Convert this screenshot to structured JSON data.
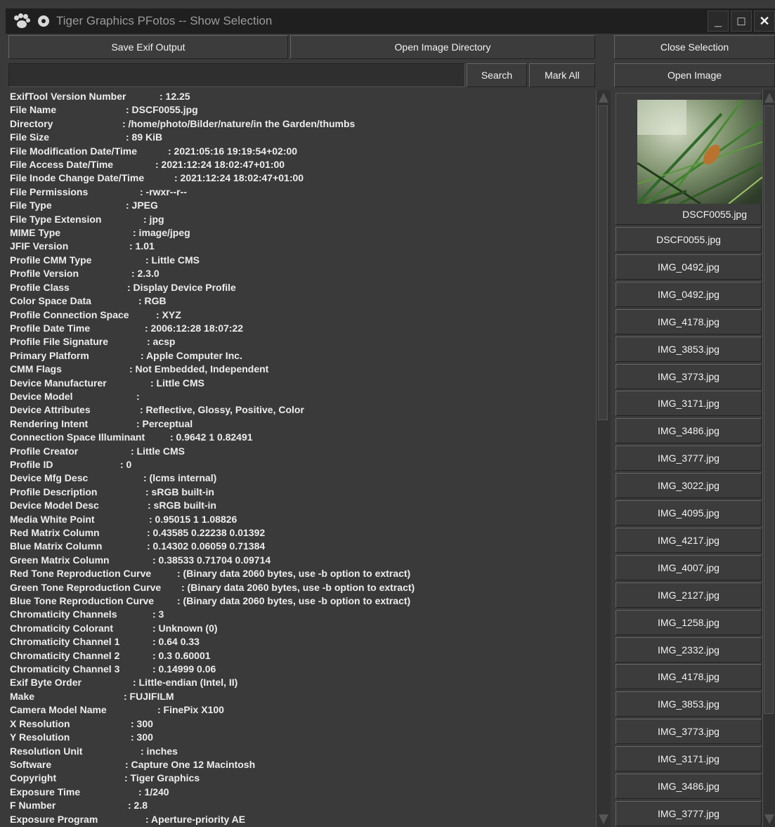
{
  "window": {
    "title": "Tiger Graphics PFotos -- Show Selection",
    "minimize": "_",
    "maximize": "□",
    "close": "✕"
  },
  "toolbar": {
    "save_exif": "Save Exif Output",
    "open_dir": "Open Image Directory",
    "close_selection": "Close Selection",
    "search": "Search",
    "mark_all": "Mark All",
    "open_image": "Open Image",
    "search_value": ""
  },
  "exif": [
    [
      "ExifTool Version Number",
      ": 12.25",
      213
    ],
    [
      "File Name",
      ": DSCF0055.jpg",
      165
    ],
    [
      "Directory",
      ": /home/photo/Bilder/nature/in the Garden/thumbs",
      160
    ],
    [
      "File Size",
      ": 89 KiB",
      165
    ],
    [
      "File Modification Date/Time",
      ": 2021:05:16 19:19:54+02:00",
      225
    ],
    [
      "File Access Date/Time",
      ": 2021:12:24 18:02:47+01:00",
      207
    ],
    [
      "File Inode Change Date/Time",
      ": 2021:12:24 18:02:47+01:00",
      234
    ],
    [
      "File Permissions",
      ": -rwxr--r--",
      185
    ],
    [
      "File Type",
      ": JPEG",
      165
    ],
    [
      "File Type Extension",
      ": jpg",
      190
    ],
    [
      "MIME Type",
      ": image/jpeg",
      175
    ],
    [
      "JFIF Version",
      ": 1.01",
      170
    ],
    [
      "Profile CMM Type",
      ": Little CMS",
      193
    ],
    [
      "Profile Version",
      ": 2.3.0",
      173
    ],
    [
      "Profile Class",
      ": Display Device Profile",
      167
    ],
    [
      "Color Space Data",
      ": RGB",
      183
    ],
    [
      "Profile Connection Space",
      ": XYZ",
      208
    ],
    [
      "Profile Date Time",
      ": 2006:12:28 18:07:22",
      192
    ],
    [
      "Profile File Signature",
      ": acsp",
      195
    ],
    [
      "Primary Platform",
      ": Apple Computer Inc.",
      186
    ],
    [
      "CMM Flags",
      ": Not Embedded, Independent",
      170
    ],
    [
      "Device Manufacturer",
      ": Little CMS",
      200
    ],
    [
      "Device Model",
      ":",
      180
    ],
    [
      "Device Attributes",
      ": Reflective, Glossy, Positive, Color",
      185
    ],
    [
      "Rendering Intent",
      ": Perceptual",
      180
    ],
    [
      "Connection Space Illuminant",
      ": 0.9642 1 0.82491",
      228
    ],
    [
      "Profile Creator",
      ": Little CMS",
      172
    ],
    [
      "Profile ID",
      ": 0",
      157
    ],
    [
      "Device Mfg Desc",
      ": (lcms internal)",
      190
    ],
    [
      "Profile Description",
      ": sRGB built-in",
      193
    ],
    [
      "Device Model Desc",
      ": sRGB built-in",
      196
    ],
    [
      "Media White Point",
      ": 0.95015 1 1.08826",
      198
    ],
    [
      "Red Matrix Column",
      ": 0.43585 0.22238 0.01392",
      195
    ],
    [
      "Blue Matrix Column",
      ": 0.14302 0.06059 0.71384",
      195
    ],
    [
      "Green Matrix Column",
      ": 0.38533 0.71704 0.09714",
      203
    ],
    [
      "Red Tone Reproduction Curve",
      ": (Binary data 2060 bytes, use -b option to extract)",
      238
    ],
    [
      "Green Tone Reproduction Curve",
      ": (Binary data 2060 bytes, use -b option to extract)",
      244
    ],
    [
      "Blue Tone Reproduction Curve",
      ": (Binary data 2060 bytes, use -b option to extract)",
      238
    ],
    [
      "Chromaticity Channels",
      ": 3",
      203
    ],
    [
      "Chromaticity Colorant",
      ": Unknown (0)",
      203
    ],
    [
      "Chromaticity Channel 1",
      ": 0.64 0.33",
      203
    ],
    [
      "Chromaticity Channel 2",
      ": 0.3 0.60001",
      203
    ],
    [
      "Chromaticity Channel 3",
      ": 0.14999 0.06",
      203
    ],
    [
      "Exif Byte Order",
      ": Little-endian (Intel, II)",
      175
    ],
    [
      "Make",
      ": FUJIFILM",
      162
    ],
    [
      "Camera Model Name",
      ": FinePix X100",
      210
    ],
    [
      "X Resolution",
      ": 300",
      172
    ],
    [
      "Y Resolution",
      ": 300",
      172
    ],
    [
      "Resolution Unit",
      ": inches",
      186
    ],
    [
      "Software",
      ": Capture One 12 Macintosh",
      164
    ],
    [
      "Copyright",
      ": Tiger Graphics",
      163
    ],
    [
      "Exposure Time",
      ": 1/240",
      183
    ],
    [
      "F Number",
      ": 2.8",
      168
    ],
    [
      "Exposure Program",
      ": Aperture-priority AE",
      193
    ]
  ],
  "images": {
    "preview_label": "DSCF0055.jpg",
    "list": [
      "DSCF0055.jpg",
      "IMG_0492.jpg",
      "IMG_0492.jpg",
      "IMG_4178.jpg",
      "IMG_3853.jpg",
      "IMG_3773.jpg",
      "IMG_3171.jpg",
      "IMG_3486.jpg",
      "IMG_3777.jpg",
      "IMG_3022.jpg",
      "IMG_4095.jpg",
      "IMG_4217.jpg",
      "IMG_4007.jpg",
      "IMG_2127.jpg",
      "IMG_1258.jpg",
      "IMG_2332.jpg",
      "IMG_4178.jpg",
      "IMG_3853.jpg",
      "IMG_3773.jpg",
      "IMG_3171.jpg",
      "IMG_3486.jpg",
      "IMG_3777.jpg"
    ]
  }
}
